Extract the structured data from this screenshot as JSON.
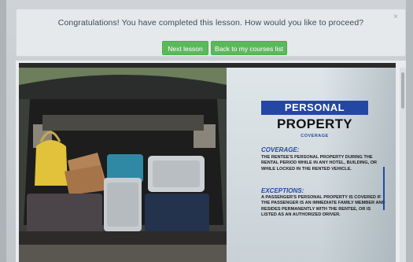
{
  "notice": {
    "message": "Congratulations! You have completed this lesson. How would you like to proceed?",
    "close_glyph": "×",
    "next_lesson_label": "Next lesson",
    "back_label": "Back to my courses list"
  },
  "slide": {
    "title_line1": "PERSONAL",
    "title_line2": "PROPERTY",
    "title_line3": "COVERAGE",
    "coverage_heading": "COVERAGE:",
    "coverage_text": "THE RENTEE'S PERSONAL PROPERTY DURING THE RENTAL PERIOD WHILE IN ANY HOTEL, BUILDING, OR WHILE LOCKED IN THE RENTED VEHICLE.",
    "exceptions_heading": "EXCEPTIONS:",
    "exceptions_text": "A PASSENGER'S PERSONAL PROPERTY IS COVERED IF THE PASSENGER IS AN IMMEDIATE FAMILY MEMBER AND RESIDES PERMANENTLY WITH THE RENTEE, OR IS LISTED AS AN AUTHORIZED DRIVER."
  },
  "colors": {
    "button_green": "#5cb85c",
    "title_blue": "#2447a5"
  }
}
